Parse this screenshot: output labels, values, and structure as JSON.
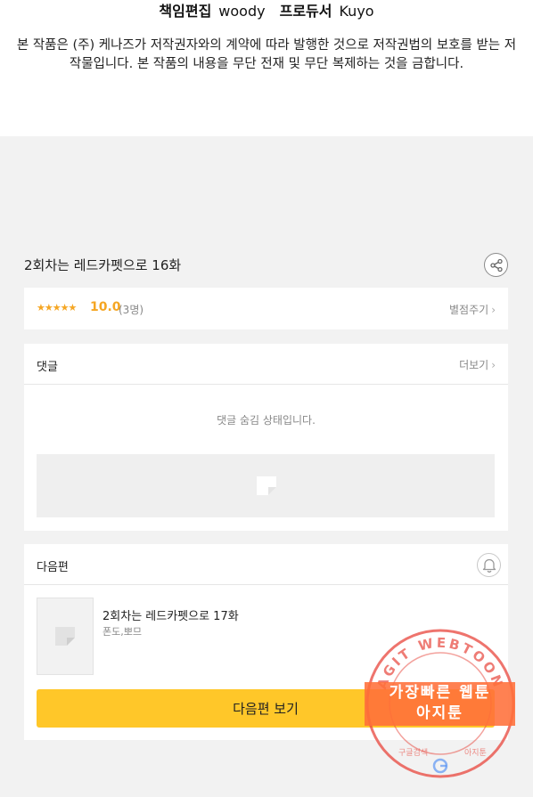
{
  "credits": {
    "editor_role": "책임편집",
    "editor_name": "woody",
    "producer_role": "프로듀서",
    "producer_name": "Kuyo"
  },
  "notice": "본 작품은 (주) 케나즈가 저작권자와의 계약에 따라 발행한 것으로 저작권법의 보호를 받는 저작물입니다. 본 작품의 내용을 무단 전재 및 무단 복제하는 것을 금합니다.",
  "episode": {
    "title": "2회차는 레드카펫으로 16화",
    "share_icon": "share-icon"
  },
  "rating": {
    "stars": "★★★★★",
    "score": "10.0",
    "count": "(3명)",
    "action_label": "별점주기",
    "chevron": "›"
  },
  "comments": {
    "label": "댓글",
    "more_label": "더보기",
    "chevron": "›",
    "hidden_message": "댓글 숨김 상태입니다."
  },
  "next_episode": {
    "label": "다음편",
    "bell_icon": "bell-icon",
    "title": "2회차는 레드카펫으로 17화",
    "author": "폰도,뽀므",
    "button_label": "다음편 보기"
  },
  "watermark": {
    "banner_line1": "가장빠른 웹툰",
    "banner_line2": "아지툰",
    "ring_text": "AGIT WEBTOON",
    "bottom_left": "구글검색",
    "bottom_right": "아지툰"
  },
  "colors": {
    "accent": "#ffc729",
    "star": "#f5a623",
    "background": "#f2f2f2",
    "watermark": "#e8453c"
  }
}
